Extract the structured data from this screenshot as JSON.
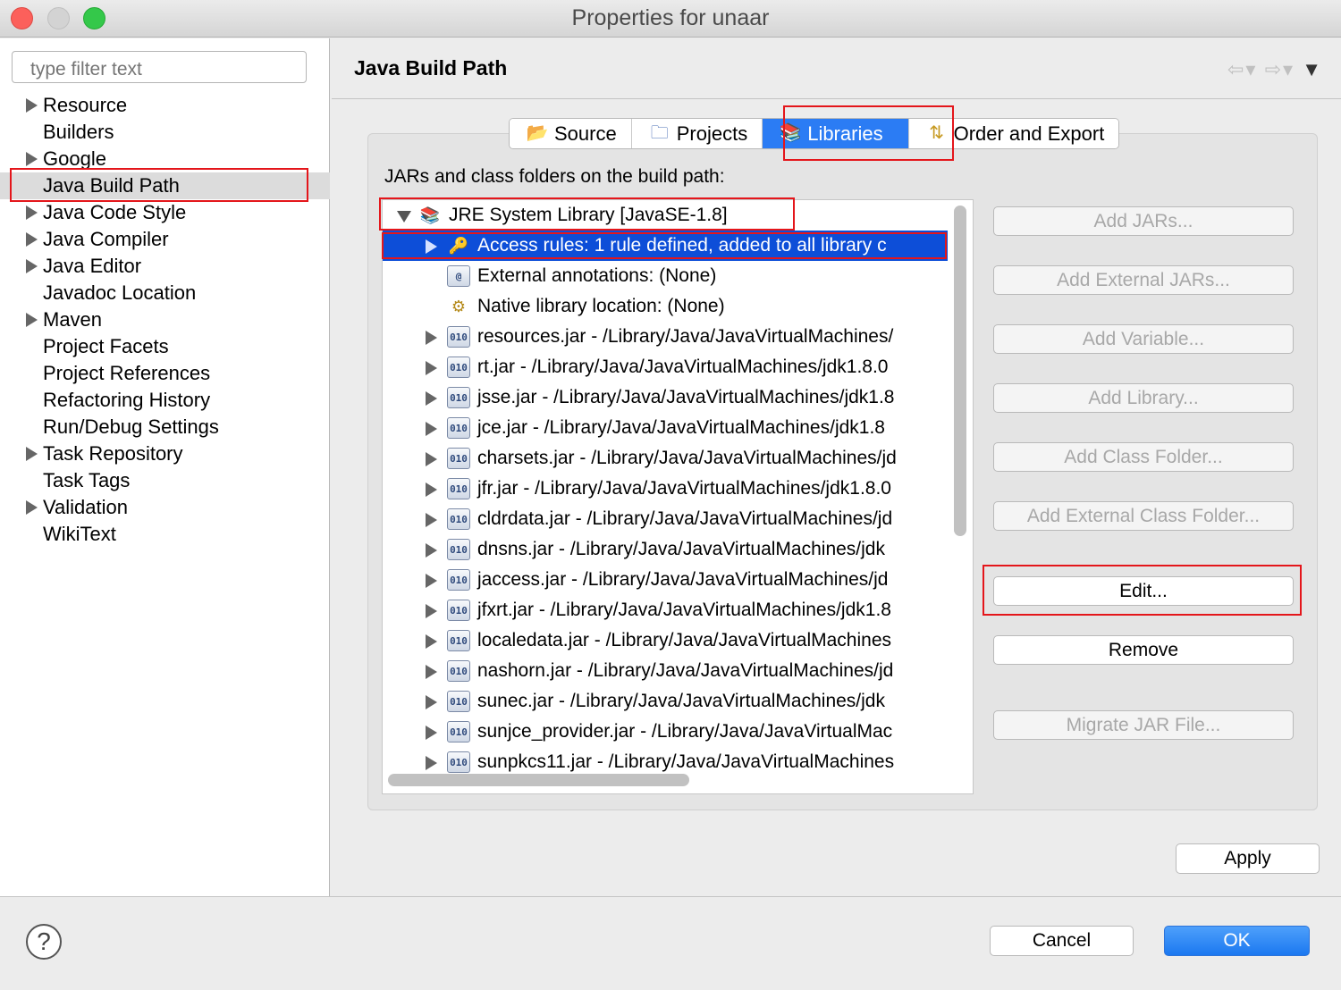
{
  "window": {
    "title": "Properties for unaar"
  },
  "sidebar": {
    "filter_placeholder": "type filter text",
    "items": [
      {
        "label": "Resource",
        "expandable": true
      },
      {
        "label": "Builders",
        "expandable": false
      },
      {
        "label": "Google",
        "expandable": true
      },
      {
        "label": "Java Build Path",
        "expandable": false,
        "selected": true
      },
      {
        "label": "Java Code Style",
        "expandable": true
      },
      {
        "label": "Java Compiler",
        "expandable": true
      },
      {
        "label": "Java Editor",
        "expandable": true
      },
      {
        "label": "Javadoc Location",
        "expandable": false
      },
      {
        "label": "Maven",
        "expandable": true
      },
      {
        "label": "Project Facets",
        "expandable": false
      },
      {
        "label": "Project References",
        "expandable": false
      },
      {
        "label": "Refactoring History",
        "expandable": false
      },
      {
        "label": "Run/Debug Settings",
        "expandable": false
      },
      {
        "label": "Task Repository",
        "expandable": true
      },
      {
        "label": "Task Tags",
        "expandable": false
      },
      {
        "label": "Validation",
        "expandable": true
      },
      {
        "label": "WikiText",
        "expandable": false
      }
    ]
  },
  "main": {
    "page_title": "Java Build Path",
    "tabs": [
      {
        "label": "Source",
        "icon": "source-folder-icon"
      },
      {
        "label": "Projects",
        "icon": "projects-folder-icon"
      },
      {
        "label": "Libraries",
        "icon": "libraries-icon",
        "active": true
      },
      {
        "label": "Order and Export",
        "icon": "order-export-icon"
      }
    ],
    "list_label": "JARs and class folders on the build path:",
    "tree": [
      {
        "text": "JRE System Library [JavaSE-1.8]",
        "level": 0,
        "icon": "library-icon",
        "expanded": true
      },
      {
        "text": "Access rules: 1 rule defined, added to all library c",
        "level": 1,
        "icon": "access-rules-icon",
        "expandable": true,
        "selected": true
      },
      {
        "text": "External annotations: (None)",
        "level": 1,
        "icon": "annotations-icon",
        "expandable": false
      },
      {
        "text": "Native library location: (None)",
        "level": 1,
        "icon": "native-library-icon",
        "expandable": false
      },
      {
        "text": "resources.jar - /Library/Java/JavaVirtualMachines/",
        "level": 1,
        "icon": "jar-icon",
        "expandable": true
      },
      {
        "text": "rt.jar - /Library/Java/JavaVirtualMachines/jdk1.8.0",
        "level": 1,
        "icon": "jar-icon",
        "expandable": true
      },
      {
        "text": "jsse.jar - /Library/Java/JavaVirtualMachines/jdk1.8",
        "level": 1,
        "icon": "jar-icon",
        "expandable": true
      },
      {
        "text": "jce.jar - /Library/Java/JavaVirtualMachines/jdk1.8",
        "level": 1,
        "icon": "jar-icon",
        "expandable": true
      },
      {
        "text": "charsets.jar - /Library/Java/JavaVirtualMachines/jd",
        "level": 1,
        "icon": "jar-icon",
        "expandable": true
      },
      {
        "text": "jfr.jar - /Library/Java/JavaVirtualMachines/jdk1.8.0",
        "level": 1,
        "icon": "jar-icon",
        "expandable": true
      },
      {
        "text": "cldrdata.jar - /Library/Java/JavaVirtualMachines/jd",
        "level": 1,
        "icon": "jar-icon",
        "expandable": true
      },
      {
        "text": "dnsns.jar - /Library/Java/JavaVirtualMachines/jdk",
        "level": 1,
        "icon": "jar-icon",
        "expandable": true
      },
      {
        "text": "jaccess.jar - /Library/Java/JavaVirtualMachines/jd",
        "level": 1,
        "icon": "jar-icon",
        "expandable": true
      },
      {
        "text": "jfxrt.jar - /Library/Java/JavaVirtualMachines/jdk1.8",
        "level": 1,
        "icon": "jar-icon",
        "expandable": true
      },
      {
        "text": "localedata.jar - /Library/Java/JavaVirtualMachines",
        "level": 1,
        "icon": "jar-icon",
        "expandable": true
      },
      {
        "text": "nashorn.jar - /Library/Java/JavaVirtualMachines/jd",
        "level": 1,
        "icon": "jar-icon",
        "expandable": true
      },
      {
        "text": "sunec.jar - /Library/Java/JavaVirtualMachines/jdk",
        "level": 1,
        "icon": "jar-icon",
        "expandable": true
      },
      {
        "text": "sunjce_provider.jar - /Library/Java/JavaVirtualMac",
        "level": 1,
        "icon": "jar-icon",
        "expandable": true
      },
      {
        "text": "sunpkcs11.jar - /Library/Java/JavaVirtualMachines",
        "level": 1,
        "icon": "jar-icon",
        "expandable": true
      }
    ],
    "buttons": [
      {
        "label": "Add JARs...",
        "enabled": false
      },
      {
        "label": "Add External JARs...",
        "enabled": false
      },
      {
        "label": "Add Variable...",
        "enabled": false
      },
      {
        "label": "Add Library...",
        "enabled": false
      },
      {
        "label": "Add Class Folder...",
        "enabled": false
      },
      {
        "label": "Add External Class Folder...",
        "enabled": false
      },
      {
        "label": "Edit...",
        "enabled": true
      },
      {
        "label": "Remove",
        "enabled": true
      },
      {
        "label": "Migrate JAR File...",
        "enabled": false
      }
    ],
    "apply_label": "Apply"
  },
  "footer": {
    "help_icon": "?",
    "cancel_label": "Cancel",
    "ok_label": "OK"
  },
  "colors": {
    "selection": "#0d4ed8",
    "active_tab": "#2b7cf4",
    "highlight_box": "#e4161b",
    "primary_button": "#1b78f0"
  }
}
